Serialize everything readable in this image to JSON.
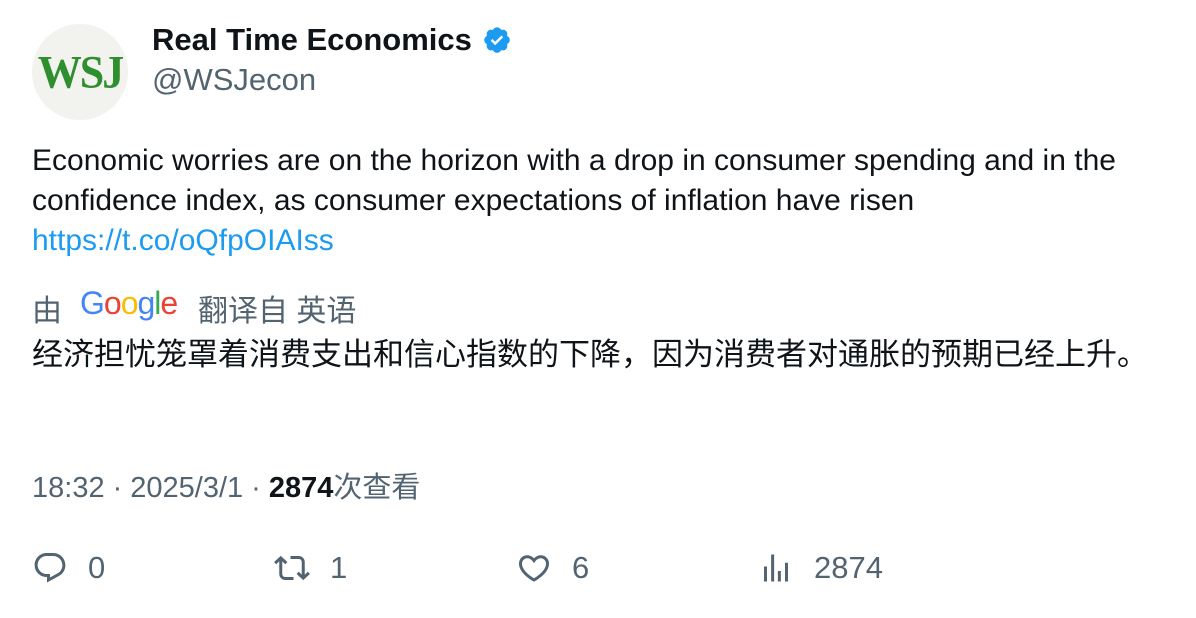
{
  "author": {
    "avatar_text": "WSJ",
    "display_name": "Real Time Economics",
    "handle": "@WSJecon"
  },
  "tweet": {
    "text": "Economic worries are on the horizon with a drop in consumer spending and in the confidence index, as consumer expectations of inflation have risen",
    "link": "https://t.co/oQfpOIAIss"
  },
  "translation": {
    "prefix": "由",
    "provider": "Google",
    "suffix": "翻译自 英语",
    "text": "经济担忧笼罩着消费支出和信心指数的下降，因为消费者对通胀的预期已经上升。"
  },
  "meta": {
    "time": "18:32",
    "separator": "·",
    "date": "2025/3/1",
    "views_count": "2874",
    "views_label": "次查看"
  },
  "actions": {
    "replies": "0",
    "retweets": "1",
    "likes": "6",
    "views": "2874"
  },
  "colors": {
    "link": "#1d9bf0",
    "verified": "#1d9bf0",
    "secondary_text": "#536471",
    "avatar_logo": "#2f8f2f"
  },
  "icons": [
    "verified-badge-icon",
    "google-logo",
    "reply-icon",
    "retweet-icon",
    "like-icon",
    "views-icon"
  ]
}
